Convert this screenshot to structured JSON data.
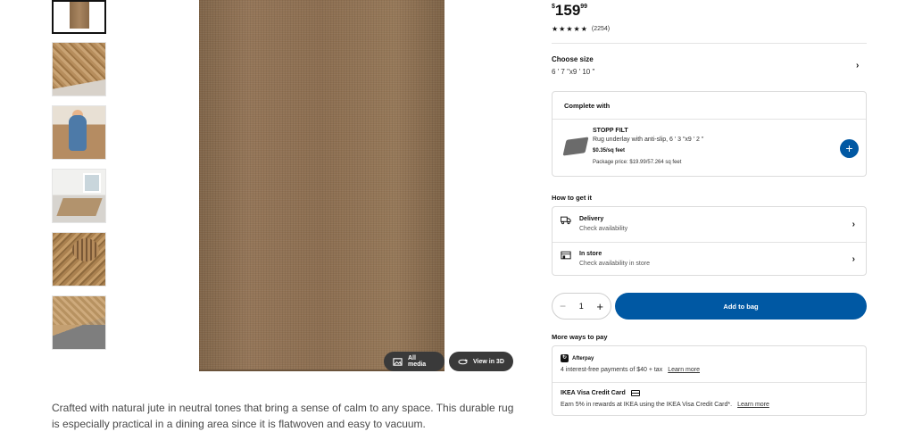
{
  "price": {
    "currency": "$",
    "whole": "159",
    "cents": "99"
  },
  "rating": {
    "stars": "★★★★★",
    "count": "(2254)"
  },
  "size": {
    "label": "Choose size",
    "value": "6 ' 7 \"x9 ' 10 \""
  },
  "complete_with": {
    "title": "Complete with",
    "product_name": "STOPP FILT",
    "product_desc": "Rug underlay with anti-slip, 6 ' 3 \"x9 ' 2 \"",
    "unit_price": "$0.35/sq feet",
    "package_price": "Package price: $19.99/57.264 sq feet",
    "add_icon": "plus-icon"
  },
  "how_to_get": {
    "title": "How to get it",
    "delivery": {
      "label": "Delivery",
      "sub": "Check availability"
    },
    "in_store": {
      "label": "In store",
      "sub": "Check availability in store"
    }
  },
  "quantity": {
    "minus": "−",
    "value": "1",
    "plus": "+"
  },
  "add_to_bag": "Add to bag",
  "more_ways": {
    "title": "More ways to pay",
    "afterpay_logo": "Afterpay",
    "afterpay_line": "4 interest-free payments of $40 + tax",
    "afterpay_link": "Learn more",
    "visa_title": "IKEA Visa Credit Card",
    "visa_line": "Earn 5% in rewards at IKEA using the IKEA Visa Credit Card*.",
    "visa_link": "Learn more"
  },
  "media": {
    "all_media": "All media",
    "view_3d": "View in 3D"
  },
  "description": "Crafted with natural jute in neutral tones that bring a sense of calm to any space. This durable rug is especially practical in a dining area since it is flatwoven and easy to vacuum.",
  "colors": {
    "accent": "#0058a3"
  }
}
